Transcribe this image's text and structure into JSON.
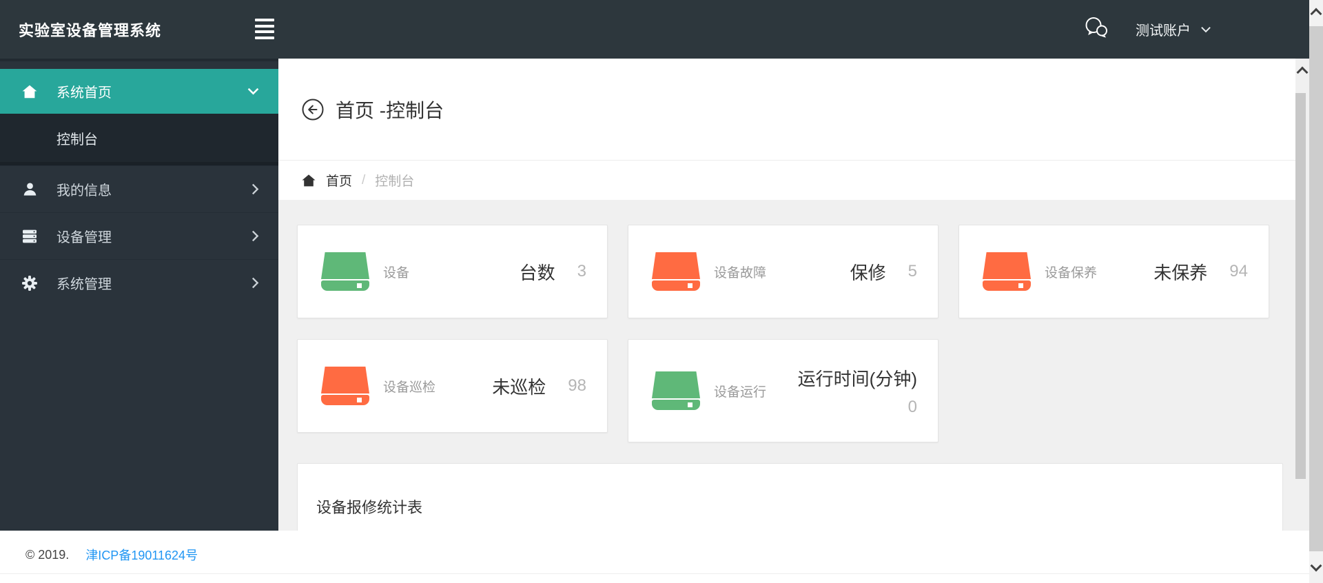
{
  "header": {
    "app_title": "实验室设备管理系统",
    "user_name": "测试账户"
  },
  "sidebar": {
    "items": [
      {
        "label": "系统首页",
        "icon": "home-icon",
        "active": true,
        "children": [
          {
            "label": "控制台",
            "active": true
          }
        ]
      },
      {
        "label": "我的信息",
        "icon": "user-icon"
      },
      {
        "label": "设备管理",
        "icon": "server-icon"
      },
      {
        "label": "系统管理",
        "icon": "gear-icon"
      }
    ]
  },
  "page": {
    "title": "首页 -控制台",
    "breadcrumb": {
      "home": "首页",
      "separator": "/",
      "current": "控制台"
    }
  },
  "stats": [
    {
      "label": "设备",
      "metric": "台数",
      "value": "3",
      "color": "green"
    },
    {
      "label": "设备故障",
      "metric": "保修",
      "value": "5",
      "color": "orange"
    },
    {
      "label": "设备保养",
      "metric": "未保养",
      "value": "94",
      "color": "orange"
    },
    {
      "label": "设备巡检",
      "metric": "未巡检",
      "value": "98",
      "color": "orange"
    },
    {
      "label": "设备运行",
      "metric": "运行时间(分钟)",
      "value": "0",
      "color": "green"
    }
  ],
  "panel": {
    "title": "设备报修统计表"
  },
  "footer": {
    "copyright": "© 2019.",
    "icp_link": "津ICP备19011624号"
  },
  "icons": [
    "hamburger-icon",
    "chat-icon",
    "caret-down-icon",
    "home-icon",
    "user-icon",
    "server-icon",
    "gear-icon",
    "chevron-down-icon",
    "chevron-right-icon",
    "arrow-circle-left-icon",
    "hdd-icon"
  ],
  "colors": {
    "accent_teal": "#28a79b",
    "stat_green": "#5fb878",
    "stat_orange": "#ff6b42",
    "link_blue": "#2196f3"
  }
}
